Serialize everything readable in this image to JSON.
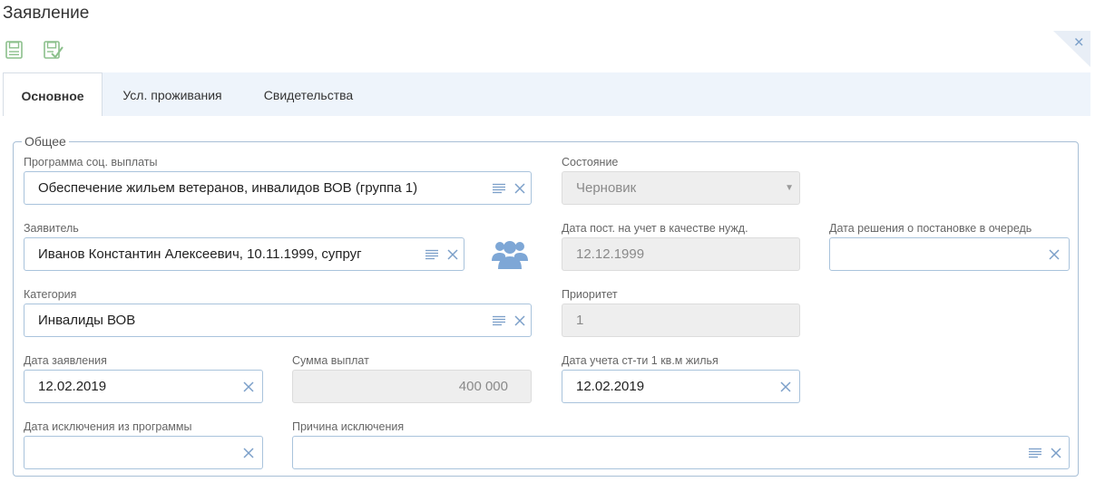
{
  "page": {
    "title": "Заявление"
  },
  "tabs": [
    {
      "label": "Основное",
      "active": true
    },
    {
      "label": "Усл. проживания",
      "active": false
    },
    {
      "label": "Свидетельства",
      "active": false
    }
  ],
  "section": {
    "legend": "Общее"
  },
  "fields": {
    "program": {
      "label": "Программа соц. выплаты",
      "value": "Обеспечение жильем ветеранов, инвалидов ВОВ (группа 1)"
    },
    "state": {
      "label": "Состояние",
      "value": "Черновик"
    },
    "applicant": {
      "label": "Заявитель",
      "value": "Иванов Константин Алексеевич, 10.11.1999, супруг"
    },
    "reg_date": {
      "label": "Дата пост. на учет в качестве нужд.",
      "value": "12.12.1999"
    },
    "queue_decision_date": {
      "label": "Дата решения о постановке в очередь",
      "value": ""
    },
    "category": {
      "label": "Категория",
      "value": "Инвалиды ВОВ"
    },
    "priority": {
      "label": "Приоритет",
      "value": "1"
    },
    "application_date": {
      "label": "Дата заявления",
      "value": "12.02.2019"
    },
    "payment_sum": {
      "label": "Сумма выплат",
      "value": "400 000"
    },
    "sqm_cost_date": {
      "label": "Дата учета ст-ти 1 кв.м жилья",
      "value": "12.02.2019"
    },
    "exclusion_date": {
      "label": "Дата исключения из программы",
      "value": ""
    },
    "exclusion_reason": {
      "label": "Причина исключения",
      "value": ""
    }
  },
  "colors": {
    "accent": "#a9c3dc",
    "icon_blue": "#7ea7d6",
    "toolbar_green": "#8cc08c",
    "tabbar_bg": "#eef4fb"
  }
}
